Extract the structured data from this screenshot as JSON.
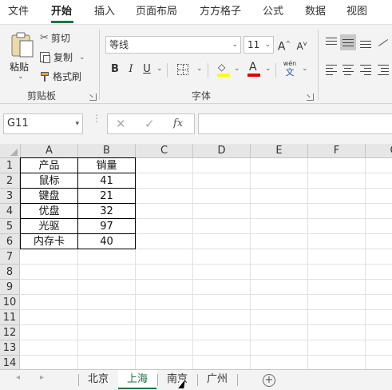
{
  "menu": {
    "tabs": [
      {
        "label": "文件"
      },
      {
        "label": "开始"
      },
      {
        "label": "插入"
      },
      {
        "label": "页面布局"
      },
      {
        "label": "方方格子"
      },
      {
        "label": "公式"
      },
      {
        "label": "数据"
      },
      {
        "label": "视图"
      }
    ],
    "active": "开始"
  },
  "ribbon": {
    "clipboard": {
      "paste": "粘贴",
      "cut": "剪切",
      "copy": "复制",
      "format_painter": "格式刷",
      "group_label": "剪贴板"
    },
    "font": {
      "font_name": "等线",
      "font_size": "11",
      "bold": "B",
      "italic": "I",
      "underline": "U",
      "phonetic_top": "wén",
      "phonetic_bottom": "文",
      "group_label": "字体"
    },
    "colors": {
      "highlight": "#ffff00",
      "font_color": "#e00000",
      "accent": "#217346"
    }
  },
  "formula_bar": {
    "name_box": "G11",
    "fx": "fx",
    "formula": ""
  },
  "sheet": {
    "columns": [
      "A",
      "B",
      "C",
      "D",
      "E",
      "F",
      "G"
    ],
    "rows": [
      "1",
      "2",
      "3",
      "4",
      "5",
      "6",
      "7",
      "8",
      "9",
      "10",
      "11",
      "12",
      "13",
      "14"
    ],
    "table": [
      [
        "产品",
        "销量"
      ],
      [
        "鼠标",
        "41"
      ],
      [
        "键盘",
        "21"
      ],
      [
        "优盘",
        "32"
      ],
      [
        "光驱",
        "97"
      ],
      [
        "内存卡",
        "40"
      ]
    ]
  },
  "sheet_tabs": {
    "tabs": [
      "北京",
      "上海",
      "南京",
      "广州"
    ],
    "active": "上海"
  }
}
